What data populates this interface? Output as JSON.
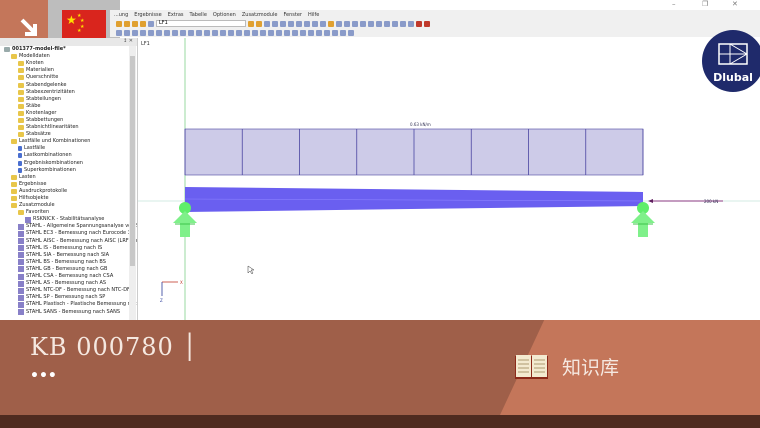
{
  "app": {
    "menu": [
      "...ung",
      "Ergebnisse",
      "Extras",
      "Tabelle",
      "Optionen",
      "Zusatzmodule",
      "Fenster",
      "Hilfe"
    ],
    "load_case_select": "LF1",
    "window_controls": [
      "–",
      "❐",
      "✕"
    ]
  },
  "navigator": {
    "header_controls": "↕ ✕",
    "items": [
      {
        "label": "001377-model-file*",
        "level": 0,
        "icon": "model"
      },
      {
        "label": "Modelldaten",
        "level": 1,
        "icon": "folder"
      },
      {
        "label": "Knoten",
        "level": 2,
        "icon": "folder"
      },
      {
        "label": "Materialien",
        "level": 2,
        "icon": "folder"
      },
      {
        "label": "Querschnitte",
        "level": 2,
        "icon": "folder"
      },
      {
        "label": "Stabendgelenke",
        "level": 2,
        "icon": "folder"
      },
      {
        "label": "Stabexzentrizitäten",
        "level": 2,
        "icon": "folder"
      },
      {
        "label": "Stabteilungen",
        "level": 2,
        "icon": "folder"
      },
      {
        "label": "Stäbe",
        "level": 2,
        "icon": "folder"
      },
      {
        "label": "Knotenlager",
        "level": 2,
        "icon": "folder"
      },
      {
        "label": "Stabbettungen",
        "level": 2,
        "icon": "folder"
      },
      {
        "label": "Stabnichtlinearitäten",
        "level": 2,
        "icon": "folder"
      },
      {
        "label": "Stabsätze",
        "level": 2,
        "icon": "folder"
      },
      {
        "label": "Lastfälle und Kombinationen",
        "level": 1,
        "icon": "folder"
      },
      {
        "label": "Lastfälle",
        "level": 2,
        "icon": "case"
      },
      {
        "label": "Lastkombinationen",
        "level": 2,
        "icon": "case"
      },
      {
        "label": "Ergebniskombinationen",
        "level": 2,
        "icon": "case"
      },
      {
        "label": "Superkombinationen",
        "level": 2,
        "icon": "case"
      },
      {
        "label": "Lasten",
        "level": 1,
        "icon": "folder"
      },
      {
        "label": "Ergebnisse",
        "level": 1,
        "icon": "folder"
      },
      {
        "label": "Ausdruckprotokolle",
        "level": 1,
        "icon": "folder"
      },
      {
        "label": "Hilfsobjekte",
        "level": 1,
        "icon": "folder"
      },
      {
        "label": "Zusatzmodule",
        "level": 1,
        "icon": "folder"
      },
      {
        "label": "Favoriten",
        "level": 2,
        "icon": "folder"
      },
      {
        "label": "RSKNICK - Stabilitätsanalyse",
        "level": 3,
        "icon": "module"
      },
      {
        "label": "STAHL - Allgemeine Spannungsanalyse von St",
        "level": 2,
        "icon": "module"
      },
      {
        "label": "STAHL EC3 - Bemessung nach Eurocode 3",
        "level": 2,
        "icon": "module"
      },
      {
        "label": "STAHL AISC - Bemessung nach AISC (LRFD od",
        "level": 2,
        "icon": "module"
      },
      {
        "label": "STAHL IS - Bemessung nach IS",
        "level": 2,
        "icon": "module"
      },
      {
        "label": "STAHL SIA - Bemessung nach SIA",
        "level": 2,
        "icon": "module"
      },
      {
        "label": "STAHL BS - Bemessung nach BS",
        "level": 2,
        "icon": "module"
      },
      {
        "label": "STAHL GB - Bemessung nach GB",
        "level": 2,
        "icon": "module"
      },
      {
        "label": "STAHL CSA - Bemessung nach CSA",
        "level": 2,
        "icon": "module"
      },
      {
        "label": "STAHL AS - Bemessung nach AS",
        "level": 2,
        "icon": "module"
      },
      {
        "label": "STAHL NTC-DF - Bemessung nach NTC-DF",
        "level": 2,
        "icon": "module"
      },
      {
        "label": "STAHL SP - Bemessung nach SP",
        "level": 2,
        "icon": "module"
      },
      {
        "label": "STAHL Plastisch - Plastische Bemessung nach",
        "level": 2,
        "icon": "module"
      },
      {
        "label": "STAHL SANS - Bemessung nach SANS",
        "level": 2,
        "icon": "module"
      }
    ]
  },
  "canvas": {
    "title": "LF1",
    "line_load_label": "0.63 kN/m",
    "force_label": "200 kN",
    "axis_x": "X",
    "axis_z": "Z"
  },
  "brand": {
    "logo_text": "Dlubal"
  },
  "banner": {
    "kb_number": "KB 000780 │",
    "ellipsis": "•••",
    "section_label": "知识库"
  },
  "colors": {
    "accent": "#c4765a",
    "banner": "#9f5f49",
    "beam": "#6a5ff0",
    "support": "#5fee6a",
    "load": "#cdcbe8"
  }
}
